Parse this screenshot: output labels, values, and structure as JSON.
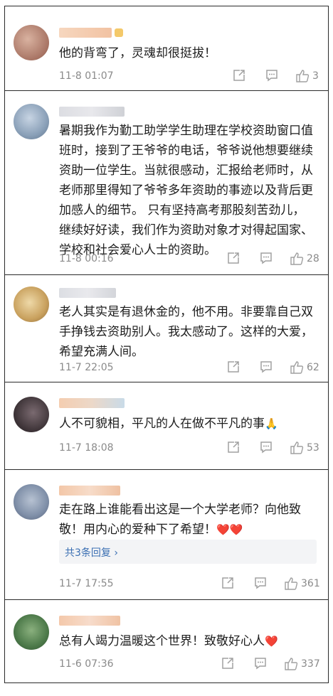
{
  "comments": [
    {
      "text": "他的背弯了，灵魂却很挺拔！",
      "time": "11-8 01:07",
      "likes": "3",
      "colors": {
        "avatar": "#b98a72",
        "name": "#f3c8a8"
      }
    },
    {
      "text": "暑期我作为勤工助学学生助理在学校资助窗口值班时，接到了王爷爷的电话，爷爷说他想要继续资助一位学生。当就很感动，汇报给老师时，从老师那里得知了爷爷多年资助的事迹以及背后更加感人的细节。 只有坚持高考那股刻苦劲儿，继续好好读，我们作为资助对象才对得起国家、学校和社会爱心人士的资助。",
      "time": "11-8 00:16",
      "likes": "28",
      "colors": {
        "avatar": "#8aa0b8",
        "name": "#d8d8dc"
      }
    },
    {
      "text": "老人其实是有退休金的，他不用。非要靠自己双手挣钱去资助别人。我太感动了。这样的大爱，希望充满人间。",
      "time": "11-7 22:05",
      "likes": "62",
      "colors": {
        "avatar": "#c9a15e",
        "name": "#d9dbe0"
      }
    },
    {
      "text": "人不可貌相，平凡的人在做不平凡的事",
      "emoji": "🙏",
      "time": "11-7 18:08",
      "likes": "53",
      "colors": {
        "avatar": "#4a4348",
        "name": "#f2c7a6"
      }
    },
    {
      "text": "走在路上谁能看出这是一个大学老师？向他致敬！用内心的爱种下了希望！",
      "emoji": "❤️❤️",
      "replies": "共3条回复 ›",
      "time": "11-7 17:55",
      "likes": "361",
      "colors": {
        "avatar": "#7f8fa8",
        "name": "#f1c3a3"
      }
    },
    {
      "text": "总有人竭力温暖这个世界！致敬好心人",
      "emoji": "❤️",
      "time": "11-6 07:36",
      "likes": "337",
      "colors": {
        "avatar": "#4d7a4a",
        "name": "#f3c6a8"
      }
    }
  ],
  "icons": {
    "share": "share-icon",
    "comment": "comment-icon",
    "like": "thumbs-up-icon"
  }
}
